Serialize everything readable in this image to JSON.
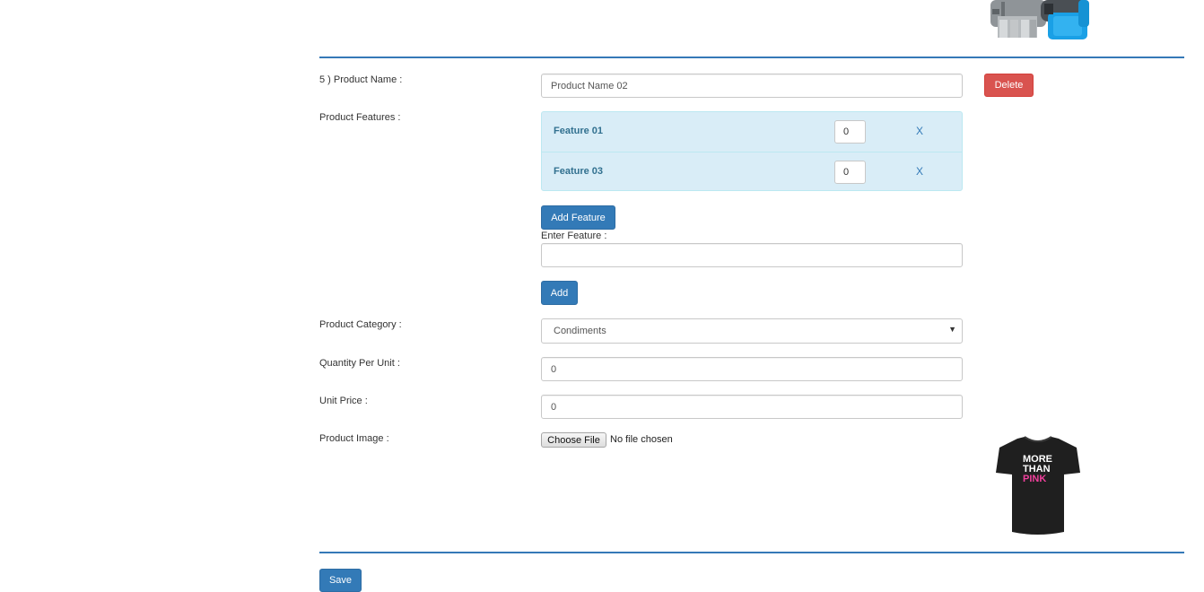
{
  "product": {
    "index_label": "5 ) Product Name :",
    "name_value": "Product Name 02",
    "delete_label": "Delete",
    "features_label": "Product Features :",
    "features": [
      {
        "name": "Feature 01",
        "qty": "0",
        "remove": "X"
      },
      {
        "name": "Feature 03",
        "qty": "0",
        "remove": "X"
      }
    ],
    "add_feature_label": "Add Feature",
    "enter_feature_label": "Enter Feature :",
    "enter_feature_value": "",
    "add_label": "Add",
    "category_label": "Product Category :",
    "category_value": "Condiments",
    "quantity_label": "Quantity Per Unit :",
    "quantity_value": "0",
    "price_label": "Unit Price :",
    "price_value": "0",
    "image_label": "Product Image :",
    "choose_file_label": "Choose File",
    "file_status": "No file chosen",
    "tshirt_text": [
      "MORE",
      "THAN",
      "PINK"
    ]
  },
  "footer": {
    "save_label": "Save"
  },
  "colors": {
    "primary": "#337ab7",
    "danger": "#d9534f",
    "divider": "#3579b7",
    "feature_bg": "#d9edf7",
    "feature_text": "#31708f",
    "watch_blue": "#1aa0e6",
    "shirt_pink": "#f0409c"
  },
  "icons": {
    "product_image_previous": "watch-image",
    "product_image_current": "tshirt-image",
    "select_arrow": "chevron-down-icon",
    "remove_feature": "close-icon"
  }
}
